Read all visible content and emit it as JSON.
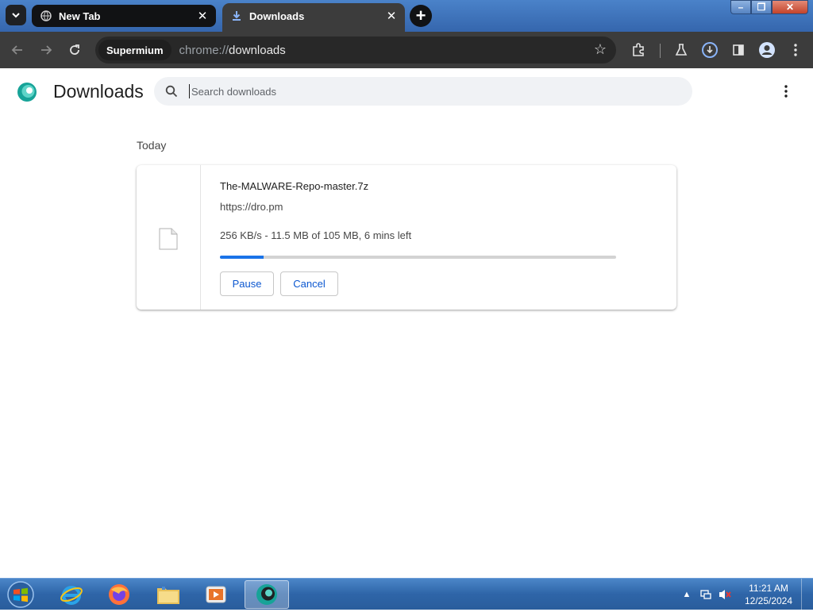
{
  "window": {
    "tabs": [
      {
        "title": "New Tab",
        "icon": "globe-icon",
        "active": false
      },
      {
        "title": "Downloads",
        "icon": "download-icon",
        "active": true
      }
    ],
    "controls": {
      "minimize": "–",
      "maximize": "❐",
      "close": "✕"
    }
  },
  "toolbar": {
    "site_chip": "Supermium",
    "url_scheme": "chrome://",
    "url_host": "downloads",
    "icons": [
      "back-icon",
      "forward-icon",
      "reload-icon",
      "bookmark-star-icon",
      "extensions-icon",
      "labs-icon",
      "downloads-indicator-icon",
      "side-panel-icon",
      "profile-icon",
      "menu-icon"
    ]
  },
  "page": {
    "title": "Downloads",
    "search_placeholder": "Search downloads"
  },
  "downloads": {
    "section_label": "Today",
    "item": {
      "file_name": "The-MALWARE-Repo-master.7z",
      "source_url": "https://dro.pm",
      "status": "256 KB/s - 11.5 MB of 105 MB, 6 mins left",
      "progress_fraction": 0.11,
      "pause_label": "Pause",
      "cancel_label": "Cancel"
    }
  },
  "taskbar": {
    "apps": [
      "internet-explorer-icon",
      "firefox-icon",
      "file-explorer-icon",
      "media-player-icon",
      "supermium-icon"
    ],
    "clock_time": "11:21 AM",
    "clock_date": "12/25/2024"
  },
  "colors": {
    "accent": "#1a73e8",
    "button_text": "#0b57d0",
    "toolbar_bg": "#3c3c3c"
  }
}
